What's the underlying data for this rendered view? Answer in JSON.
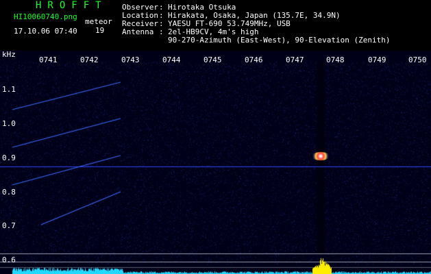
{
  "header": {
    "logo": "HROFFT",
    "filename": "HI10060740.png",
    "type_label": "meteor",
    "count": "19",
    "timestamp": "17.10.06 07:40",
    "rows": [
      {
        "label": "Observer",
        "value": "Hirotaka Otsuka"
      },
      {
        "label": "Location",
        "value": "Hirakata, Osaka, Japan (135.7E, 34.9N)"
      },
      {
        "label": "Receiver",
        "value": "YAESU FT-690 53.749MHz, USB"
      },
      {
        "label": "Antenna",
        "value": "2el-HB9CV, 4m's high"
      }
    ],
    "antenna_line2": "90-270-Azimuth (East-West), 90-Elevation (Zenith)"
  },
  "axis": {
    "unit": "kHz",
    "time_ticks": [
      "0741",
      "0742",
      "0743",
      "0744",
      "0745",
      "0746",
      "0747",
      "0748",
      "0749",
      "0750"
    ],
    "freq_ticks": [
      "1.1",
      "1.0",
      "0.9",
      "0.8",
      "0.7",
      "0.6"
    ]
  },
  "colors": {
    "background": "#000018",
    "noise": "#1a1f66",
    "trace": "#3a6cff",
    "carrier": "#2a44ff",
    "histogram": "#22d8ff",
    "burst": "#ffee00",
    "header_green": "#1aff2a"
  }
}
